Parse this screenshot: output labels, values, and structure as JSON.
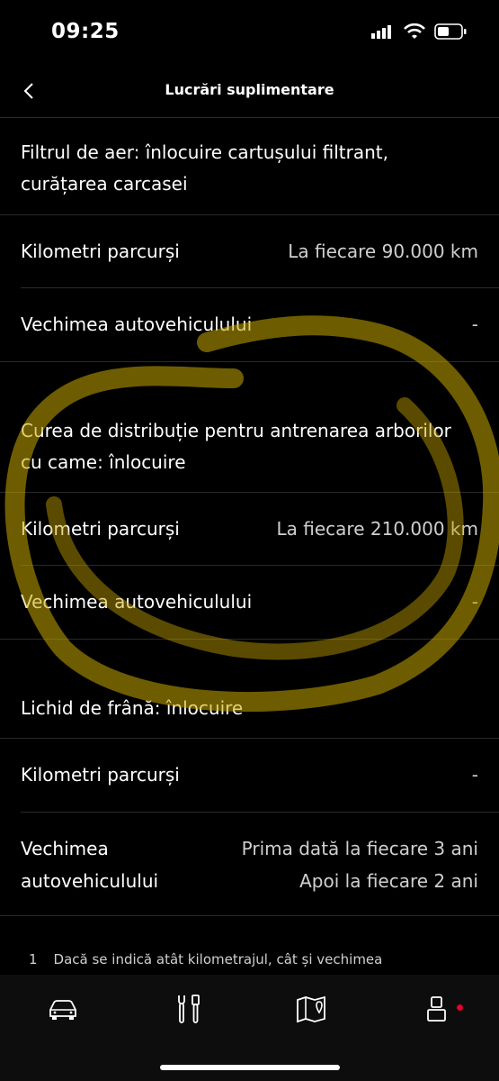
{
  "status_bar": {
    "time": "09:25"
  },
  "header": {
    "title": "Lucrări suplimentare"
  },
  "sections": [
    {
      "title_line1": "Filtrul de aer: înlocuire cartușului filtrant,",
      "title_line2": "curățarea carcasei",
      "rows": [
        {
          "label": "Kilometri parcurși",
          "value": "La fiecare 90.000 km"
        },
        {
          "label": "Vechimea autovehiculului",
          "value": "-"
        }
      ]
    },
    {
      "title_line1": "Curea de distribuție pentru antrenarea arborilor",
      "title_line2": "cu came: înlocuire",
      "rows": [
        {
          "label": "Kilometri parcurși",
          "value": "La fiecare 210.000 km"
        },
        {
          "label": "Vechimea autovehiculului",
          "value": "-"
        }
      ]
    },
    {
      "title_line1": "Lichid de frână: înlocuire",
      "rows": [
        {
          "label": "Kilometri parcurși",
          "value": "-"
        },
        {
          "label_line1": "Vechimea",
          "label_line2": "autovehiculului",
          "value_line1": "Prima dată la fiecare 3 ani",
          "value_line2": "Apoi la fiecare 2 ani"
        }
      ]
    }
  ],
  "footnote": {
    "number": "1",
    "text": "Dacă se indică atât kilometrajul, cât și vechimea"
  },
  "tab_bar": {
    "tabs": [
      {
        "icon": "car-icon"
      },
      {
        "icon": "service-tools-icon"
      },
      {
        "icon": "map-icon"
      },
      {
        "icon": "profile-icon",
        "badge_color": "#e3002b"
      }
    ]
  },
  "colors": {
    "background": "#000000",
    "separator": "#2a2a2a",
    "highlight": "#c9a700"
  }
}
